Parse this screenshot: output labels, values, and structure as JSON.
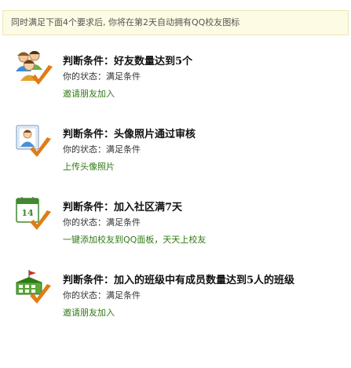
{
  "notice": {
    "text": "同时满足下面4个要求后, 你将在第2天自动拥有QQ校友图标"
  },
  "conditions": [
    {
      "title": "判断条件：好友数量达到5个",
      "status": "你的状态：满足条件",
      "action": "邀请朋友加入",
      "icon": "friends-icon"
    },
    {
      "title": "判断条件：头像照片通过审核",
      "status": "你的状态：满足条件",
      "action": "上传头像照片",
      "icon": "avatar-photo-icon"
    },
    {
      "title": "判断条件：加入社区满7天",
      "status": "你的状态：满足条件",
      "action": "一键添加校友到QQ面板，天天上校友",
      "icon": "calendar-icon",
      "calendar_day": "14"
    },
    {
      "title": "判断条件：加入的班级中有成员数量达到5人的班级",
      "status": "你的状态：满足条件",
      "action": "邀请朋友加入",
      "icon": "class-building-icon"
    }
  ],
  "colors": {
    "action_link": "#2f7a14",
    "checkmark": "#e07c16",
    "notice_bg": "#fdfbe3",
    "calendar_green": "#3e8a2c",
    "flag_red": "#d92b1f"
  }
}
